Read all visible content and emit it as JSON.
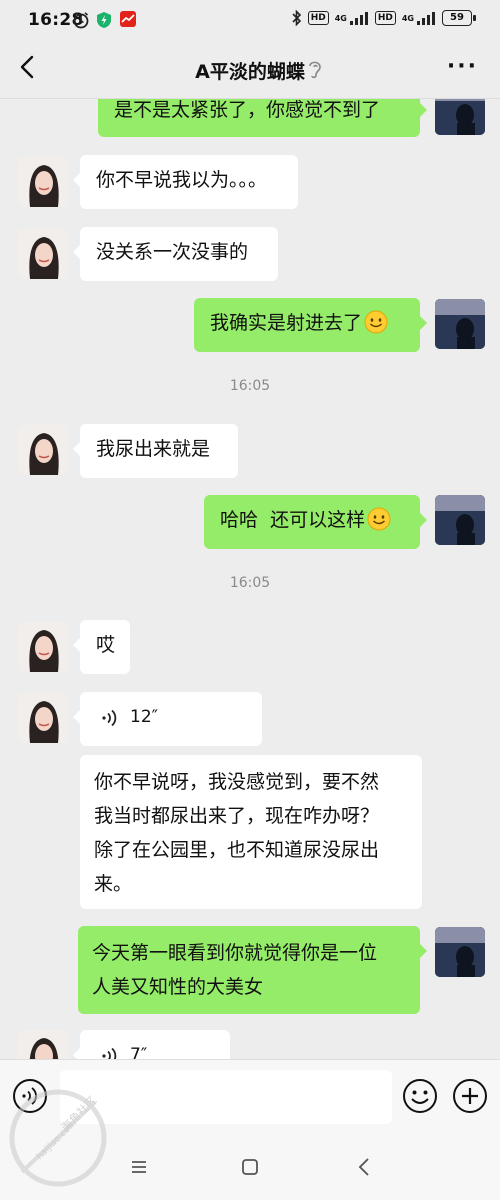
{
  "status_bar": {
    "time": "16:28",
    "network_1": "HD",
    "network_2": "HD",
    "signal_label_1": "4G",
    "signal_label_2": "4G",
    "battery": "59"
  },
  "header": {
    "title": "A平淡的蝴蝶"
  },
  "messages": {
    "m1": "是不是太紧张了，你感觉不到了",
    "m2": "你不早说我以为。。。",
    "m3": "没关系一次没事的",
    "m4": "我确实是射进去了",
    "t1": "16:05",
    "m5": "我尿出来就是",
    "m6": "哈哈  还可以这样",
    "t2": "16:05",
    "m7": "哎",
    "v1": "12″",
    "m8": [
      "你不早说呀，我没感觉到，要不然",
      "我当时都尿出来了，现在咋办呀？",
      "除了在公园里，也不知道尿没尿出",
      "来。"
    ],
    "m9": [
      "今天第一眼看到你就觉得你是一位",
      "人美又知性的大美女"
    ],
    "v2": "7″"
  },
  "input": {
    "placeholder": ""
  },
  "watermark": {
    "text_cn": "海角社区",
    "text_url": "haijiao.com"
  },
  "colors": {
    "sent_bubble": "#95ec69",
    "received_bubble": "#ffffff",
    "background": "#ededed"
  }
}
